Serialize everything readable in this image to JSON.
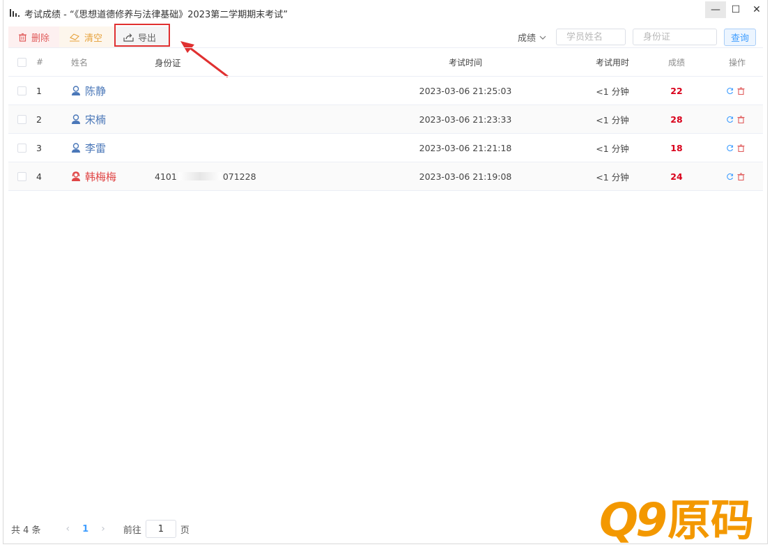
{
  "window": {
    "title": "考试成绩 - “《思想道德修养与法律基础》2023第二学期期末考试”",
    "minimize": "—",
    "maximize": "☐",
    "close": "✕"
  },
  "toolbar": {
    "delete_label": "删除",
    "clear_label": "清空",
    "export_label": "导出",
    "sort_label": "成绩",
    "name_placeholder": "学员姓名",
    "id_placeholder": "身份证",
    "query_label": "查询"
  },
  "table": {
    "headers": {
      "index": "#",
      "name": "姓名",
      "id": "身份证",
      "time": "考试时间",
      "duration": "考试用时",
      "score": "成绩",
      "ops": "操作"
    },
    "rows": [
      {
        "index": "1",
        "name": "陈静",
        "gender": "male",
        "id": "",
        "time": "2023-03-06 21:25:03",
        "duration": "<1 分钟",
        "score": "22"
      },
      {
        "index": "2",
        "name": "宋楠",
        "gender": "male",
        "id": "",
        "time": "2023-03-06 21:23:33",
        "duration": "<1 分钟",
        "score": "28"
      },
      {
        "index": "3",
        "name": "李雷",
        "gender": "male",
        "id": "",
        "time": "2023-03-06 21:21:18",
        "duration": "<1 分钟",
        "score": "18"
      },
      {
        "index": "4",
        "name": "韩梅梅",
        "gender": "female",
        "id_prefix": "4101",
        "id_suffix": "071228",
        "time": "2023-03-06 21:19:08",
        "duration": "<1 分钟",
        "score": "24"
      }
    ]
  },
  "pager": {
    "total": "共 4 条",
    "current": "1",
    "goto_label": "前往",
    "goto_value": "1",
    "page_suffix": "页"
  },
  "watermark": {
    "mark": "Q9",
    "text": "原码"
  },
  "colors": {
    "accent": "#409eff",
    "danger": "#d9001b",
    "warning": "#e6a23c",
    "male": "#4a77b8",
    "female": "#e04646",
    "highlight": "#e03030"
  }
}
